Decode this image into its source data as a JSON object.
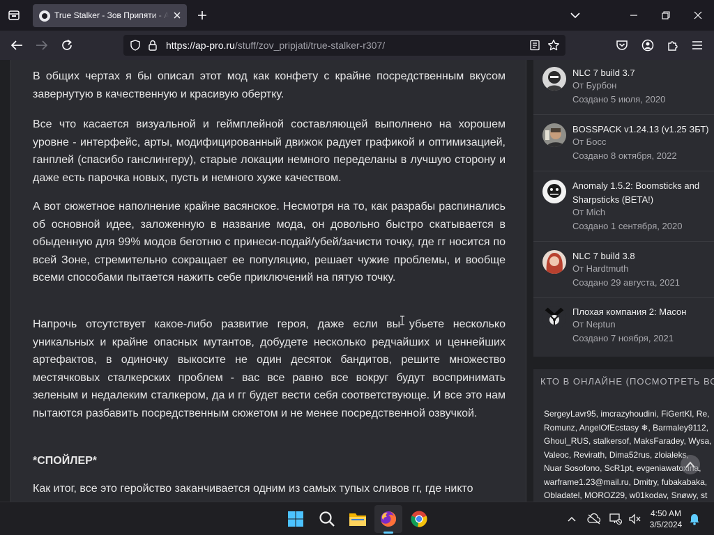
{
  "browser": {
    "tab": {
      "title": "True Stalker - Зов Припяти - AP-PRO"
    },
    "url": {
      "host": "https://ap-pro.ru",
      "path": "/stuff/zov_pripjati/true-stalker-r307/"
    }
  },
  "article": {
    "paragraphs": [
      "В общих чертах я бы описал этот мод как конфету с крайне посредственным вкусом завернутую в качественную и красивую обертку.",
      "Все что касается визуальной и геймплейной составляющей выполнено на хорошем уровне - интерфейс, арты, модифицированный движок радует графикой и оптимизацией, ганплей (спасибо ганслингеру), старые локации немного переделаны в лучшую сторону и даже есть парочка новых, пусть и немного хуже качеством.",
      "А вот сюжетное наполнение крайне васянское. Несмотря на то, как разрабы распинались об основной идее, заложенную в название мода, он довольно быстро скатывается в обыденную для 99% модов беготню с принеси-подай/убей/зачисти точку, где гг носится по всей Зоне, стремительно сокращает ее популяцию, решает чужие проблемы, и вообще всеми способами пытается нажить себе приключений на пятую точку.",
      "Напрочь отсутствует какое-либо развитие героя, даже если вы убьете несколько уникальных и крайне опасных мутантов, добудете несколько редчайших и ценнейших артефактов, в одиночку выкосите не один десяток бандитов, решите множество местячковых сталкерских проблем - вас все равно все вокруг будут воспринимать зеленым и недалеким сталкером, да и гг будет вести себя соответствующе. И все это нам пытаются разбавить посредственным сюжетом и не менее посредственной озвучкой.",
      "*СПОЙЛЕР*",
      "Как итог, все это геройство заканчивается одним из самых тупых сливов гг, где никто"
    ]
  },
  "sidebar": {
    "topics": [
      {
        "title": "NLC 7 build 3.7",
        "author": "От Бурбон",
        "created": "Создано 5 июля, 2020"
      },
      {
        "title": "BOSSPACK v1.24.13 (v1.25 ЗБТ)",
        "author": "От Босс",
        "created": "Создано 8 октября, 2022"
      },
      {
        "title": "Anomaly 1.5.2: Boomsticks and Sharpsticks (BETA!)",
        "author": "От Mich",
        "created": "Создано 1 сентября, 2020"
      },
      {
        "title": "NLC 7 build 3.8",
        "author": "От Hardtmuth",
        "created": "Создано 29 августа, 2021"
      },
      {
        "title": "Плохая компания 2: Масон",
        "author": "От Neptun",
        "created": "Создано 7 ноября, 2021"
      }
    ],
    "online": {
      "heading": "КТО В ОНЛАЙНЕ (ПОСМОТРЕТЬ ВСЕХ)",
      "users": [
        "SergeyLavr95",
        "imcrazyhoudini",
        "FiGertKl",
        "Re",
        "Romunz",
        "AngelOfEcstasy ❄",
        "Barmaley9112",
        "Ghoul_RUS",
        "stalkersof",
        "MaksFaradey",
        "Wysa",
        "Valeoc",
        "Revirath",
        "Dima52rus",
        "zloialeks",
        "Nuar Sosofono",
        "ScR1pt",
        "evgeniawatoxina",
        "warframe1.23@mail.ru",
        "Dmitry",
        "fubakabaka",
        "Obladatel",
        "MOROZ29",
        "w01kodav",
        "Snøwy",
        "st"
      ]
    }
  },
  "taskbar": {
    "time": "4:50 AM",
    "date": "3/5/2024"
  },
  "colors": {
    "accent": "#60cdff",
    "page_bg": "#1f2023",
    "card_bg": "#2b2c31"
  }
}
